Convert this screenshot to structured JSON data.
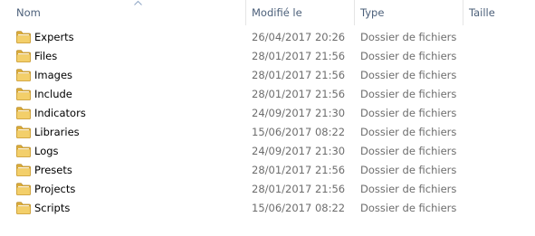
{
  "columns": {
    "name": "Nom",
    "modified": "Modifié le",
    "type": "Type",
    "size": "Taille"
  },
  "icons": {
    "folder": "folder-icon",
    "sort": "sort-ascending-icon"
  },
  "colors": {
    "header_text": "#4c607a",
    "detail_text": "#6d6d6d",
    "folder_yellow": "#e8b94a"
  },
  "files": [
    {
      "name": "Experts",
      "modified": "26/04/2017 20:26",
      "type": "Dossier de fichiers"
    },
    {
      "name": "Files",
      "modified": "28/01/2017 21:56",
      "type": "Dossier de fichiers"
    },
    {
      "name": "Images",
      "modified": "28/01/2017 21:56",
      "type": "Dossier de fichiers"
    },
    {
      "name": "Include",
      "modified": "28/01/2017 21:56",
      "type": "Dossier de fichiers"
    },
    {
      "name": "Indicators",
      "modified": "24/09/2017 21:30",
      "type": "Dossier de fichiers"
    },
    {
      "name": "Libraries",
      "modified": "15/06/2017 08:22",
      "type": "Dossier de fichiers"
    },
    {
      "name": "Logs",
      "modified": "24/09/2017 21:30",
      "type": "Dossier de fichiers"
    },
    {
      "name": "Presets",
      "modified": "28/01/2017 21:56",
      "type": "Dossier de fichiers"
    },
    {
      "name": "Projects",
      "modified": "28/01/2017 21:56",
      "type": "Dossier de fichiers"
    },
    {
      "name": "Scripts",
      "modified": "15/06/2017 08:22",
      "type": "Dossier de fichiers"
    }
  ]
}
